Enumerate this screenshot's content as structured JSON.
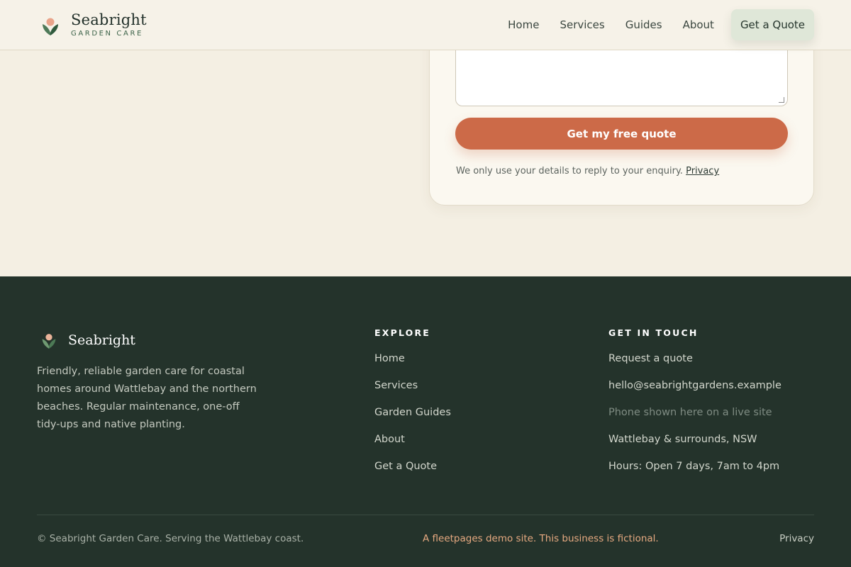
{
  "header": {
    "brand_name": "Seabright",
    "brand_tagline": "GARDEN CARE",
    "nav": [
      {
        "label": "Home"
      },
      {
        "label": "Services"
      },
      {
        "label": "Guides"
      },
      {
        "label": "About"
      }
    ],
    "cta_label": "Get a Quote"
  },
  "form": {
    "message_value": "",
    "submit_label": "Get my free quote",
    "privacy_text": "We only use your details to reply to your enquiry.",
    "privacy_link": "Privacy"
  },
  "footer": {
    "brand_name": "Seabright",
    "description": "Friendly, reliable garden care for coastal homes around Wattlebay and the northern beaches. Regular maintenance, one-off tidy-ups and native planting.",
    "explore": {
      "heading": "EXPLORE",
      "links": [
        "Home",
        "Services",
        "Garden Guides",
        "About",
        "Get a Quote"
      ]
    },
    "contact": {
      "heading": "GET IN TOUCH",
      "request": "Request a quote",
      "email": "hello@seabrightgardens.example",
      "phone": "Phone shown here on a live site",
      "location": "Wattlebay & surrounds, NSW",
      "hours": "Hours: Open 7 days, 7am to 4pm"
    },
    "copyright": "© Seabright Garden Care. Serving the Wattlebay coast.",
    "demo_note": "A fleetpages demo site. This business is fictional.",
    "privacy_label": "Privacy"
  },
  "colors": {
    "accent": "#cc6a48",
    "footer_bg": "#24332b",
    "page_bg": "#f4efe3",
    "brand_green": "#3b6248"
  },
  "icons": {
    "brand": "tulip-icon"
  }
}
